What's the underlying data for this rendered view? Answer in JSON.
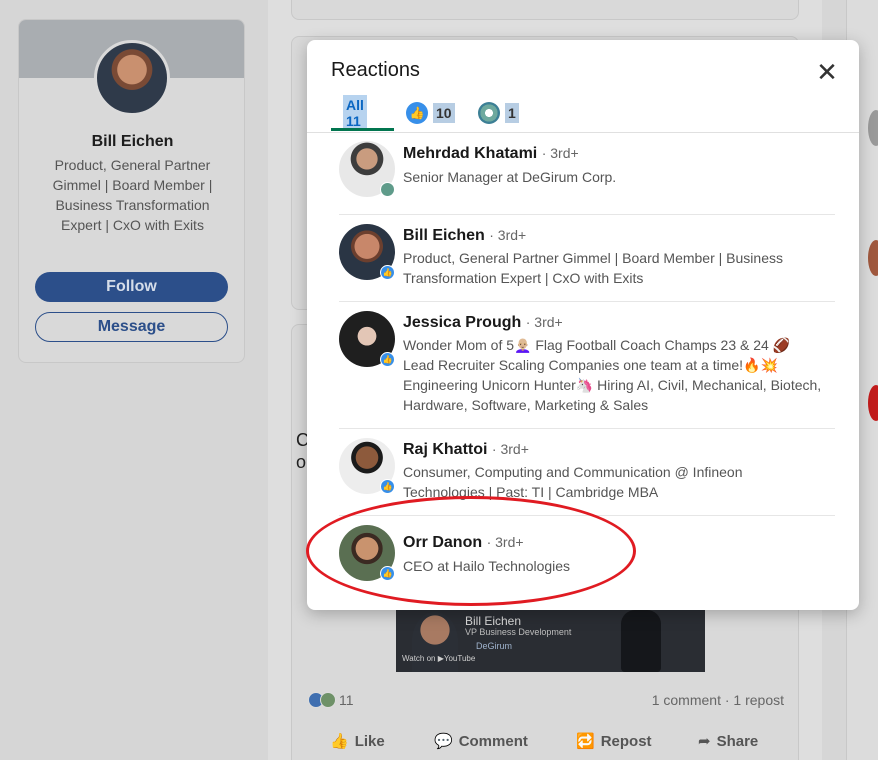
{
  "background": {
    "profile": {
      "name": "Bill Eichen",
      "headline": "Product, General Partner Gimmel | Board Member | Business Transformation Expert | CxO with Exits",
      "follow_label": "Follow",
      "message_label": "Message"
    },
    "feed_letters": [
      "C",
      "o"
    ],
    "video": {
      "name": "Bill Eichen",
      "role": "VP Business Development",
      "brand": "DeGirum",
      "watch_label": "Watch on ▶YouTube"
    },
    "post_stats": {
      "reaction_count": "11",
      "comments_reposts": "1 comment · 1 repost"
    },
    "actions": {
      "like": "Like",
      "comment": "Comment",
      "repost": "Repost",
      "share": "Share"
    }
  },
  "modal": {
    "title": "Reactions",
    "close_glyph": "✕",
    "tabs": [
      {
        "label": "All 11",
        "icon": ""
      },
      {
        "label": "10",
        "icon": "like-icon"
      },
      {
        "label": "1",
        "icon": "support-icon"
      }
    ],
    "reactors": [
      {
        "name": "Mehrdad Khatami",
        "degree": "· 3rd+",
        "headline": "Senior Manager at DeGirum Corp.",
        "reaction": "support"
      },
      {
        "name": "Bill Eichen",
        "degree": "· 3rd+",
        "headline": "Product, General Partner Gimmel | Board Member | Business Transformation Expert | CxO with Exits",
        "reaction": "like"
      },
      {
        "name": "Jessica Prough",
        "degree": "· 3rd+",
        "headline": "Wonder Mom of 5👩🏼‍🦲 Flag Football Coach Champs 23 & 24 🏈 Lead Recruiter Scaling Companies one team at a time!🔥💥 Engineering Unicorn Hunter🦄 Hiring AI, Civil, Mechanical, Biotech, Hardware, Software, Marketing & Sales",
        "reaction": "like"
      },
      {
        "name": "Raj Khattoi",
        "degree": "· 3rd+",
        "headline": "Consumer, Computing and Communication @ Infineon Technologies | Past: TI | Cambridge MBA",
        "reaction": "like"
      },
      {
        "name": "Orr Danon",
        "degree": "· 3rd+",
        "headline": "CEO at Hailo Technologies",
        "reaction": "like"
      }
    ]
  },
  "colors": {
    "like": "#378fe9",
    "support": "#5f9b8a",
    "tab_underline": "#01754f",
    "annotation": "#e01b22"
  }
}
